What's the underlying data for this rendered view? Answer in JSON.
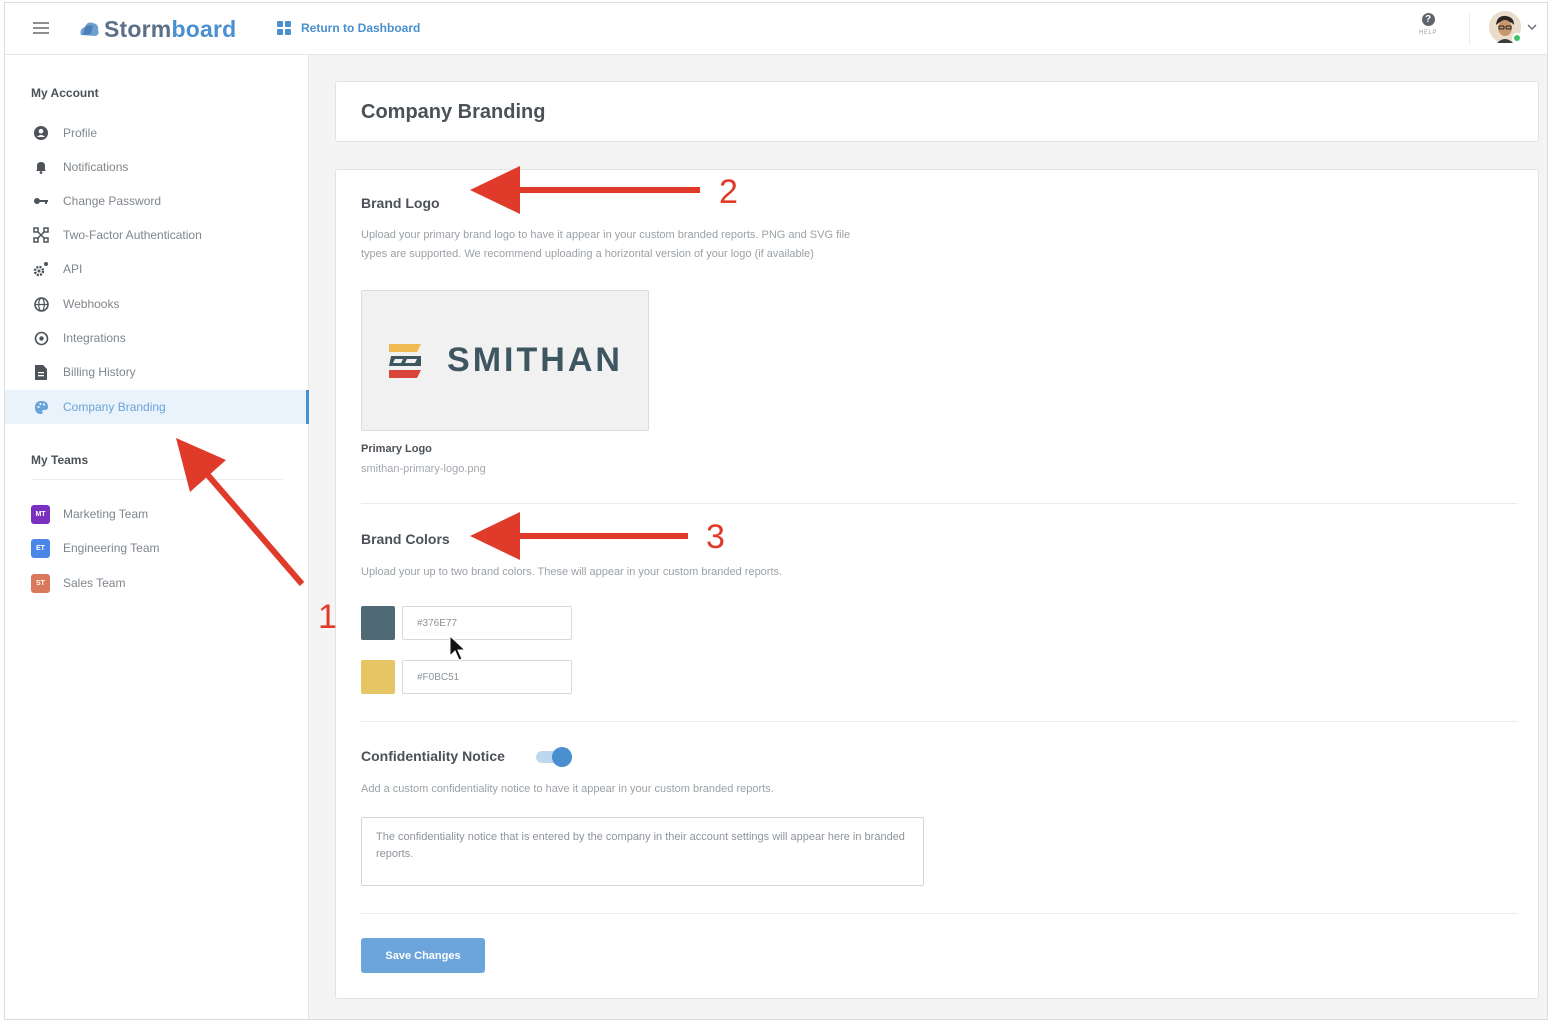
{
  "header": {
    "brand_part1": "Storm",
    "brand_part2": "board",
    "return_label": "Return to Dashboard",
    "help_label": "HELP",
    "icons": [
      "hamburger-icon",
      "stormboard-logo-icon",
      "dashboard-grid-icon",
      "help-icon",
      "avatar",
      "chevron-down-icon"
    ]
  },
  "sidebar": {
    "account_heading": "My Account",
    "items": [
      {
        "label": "Profile",
        "icon": "profile-icon"
      },
      {
        "label": "Notifications",
        "icon": "bell-icon"
      },
      {
        "label": "Change Password",
        "icon": "key-icon"
      },
      {
        "label": "Two-Factor Authentication",
        "icon": "two-factor-icon"
      },
      {
        "label": "API",
        "icon": "api-gear-icon"
      },
      {
        "label": "Webhooks",
        "icon": "globe-icon"
      },
      {
        "label": "Integrations",
        "icon": "integrations-icon"
      },
      {
        "label": "Billing History",
        "icon": "document-icon"
      },
      {
        "label": "Company Branding",
        "icon": "palette-icon",
        "active": true
      }
    ],
    "teams_heading": "My Teams",
    "teams": [
      {
        "badge": "MT",
        "label": "Marketing Team",
        "color": "#7b2fbf"
      },
      {
        "badge": "ET",
        "label": "Engineering Team",
        "color": "#4a86e8"
      },
      {
        "badge": "ST",
        "label": "Sales Team",
        "color": "#d9785a"
      }
    ]
  },
  "page": {
    "title": "Company Branding",
    "brand_logo": {
      "title": "Brand Logo",
      "desc_line1": "Upload your primary brand logo to have it appear in your custom branded reports. PNG and SVG file",
      "desc_line2": "types are supported. We recommend uploading a horizontal version of your logo (if available)",
      "logo_text": "SMITHAN",
      "caption": "Primary Logo",
      "filename": "smithan-primary-logo.png"
    },
    "brand_colors": {
      "title": "Brand Colors",
      "desc": "Upload your up to two brand colors. These will appear in your custom branded reports.",
      "color1": "#376E77",
      "color2": "#F0BC51"
    },
    "confidentiality": {
      "title": "Confidentiality Notice",
      "enabled": true,
      "desc": "Add a custom confidentiality notice to have it appear in your custom branded reports.",
      "notice_text": "The confidentiality notice that is entered by the company in their account settings will appear here in branded reports."
    },
    "save_label": "Save Changes"
  },
  "annotations": {
    "arrow_color": "#e03a2b",
    "labels": [
      "1",
      "2",
      "3"
    ]
  }
}
